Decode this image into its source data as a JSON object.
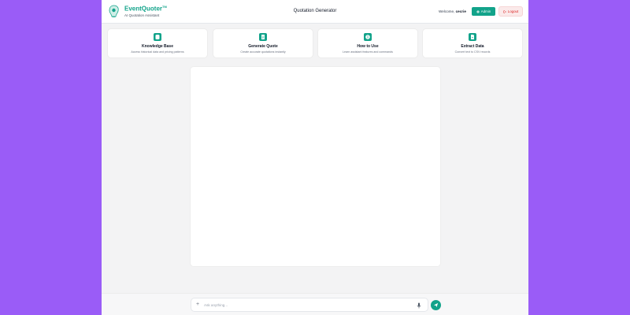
{
  "header": {
    "brand_title": "EventQuoter",
    "brand_tm": "TM",
    "brand_subtitle": "AI Quotation Assistant",
    "page_title": "Quotation Generator",
    "welcome_prefix": "Welcome,",
    "username": "cecrie",
    "admin_label": "Admin",
    "logout_label": "Logout"
  },
  "cards": [
    {
      "title": "Knowledge Base",
      "desc": "Access historical data and pricing patterns",
      "icon": "database-icon"
    },
    {
      "title": "Generate Quote",
      "desc": "Create accurate quotations instantly",
      "icon": "document-icon"
    },
    {
      "title": "How to Use",
      "desc": "Learn assistant features and commands",
      "icon": "info-icon"
    },
    {
      "title": "Extract Data",
      "desc": "Convert text to CSV records",
      "icon": "file-export-icon"
    }
  ],
  "composer": {
    "placeholder": "Ask anything..."
  },
  "colors": {
    "accent": "#12a38a",
    "background": "#9a5cf7",
    "danger": "#dc2626"
  }
}
